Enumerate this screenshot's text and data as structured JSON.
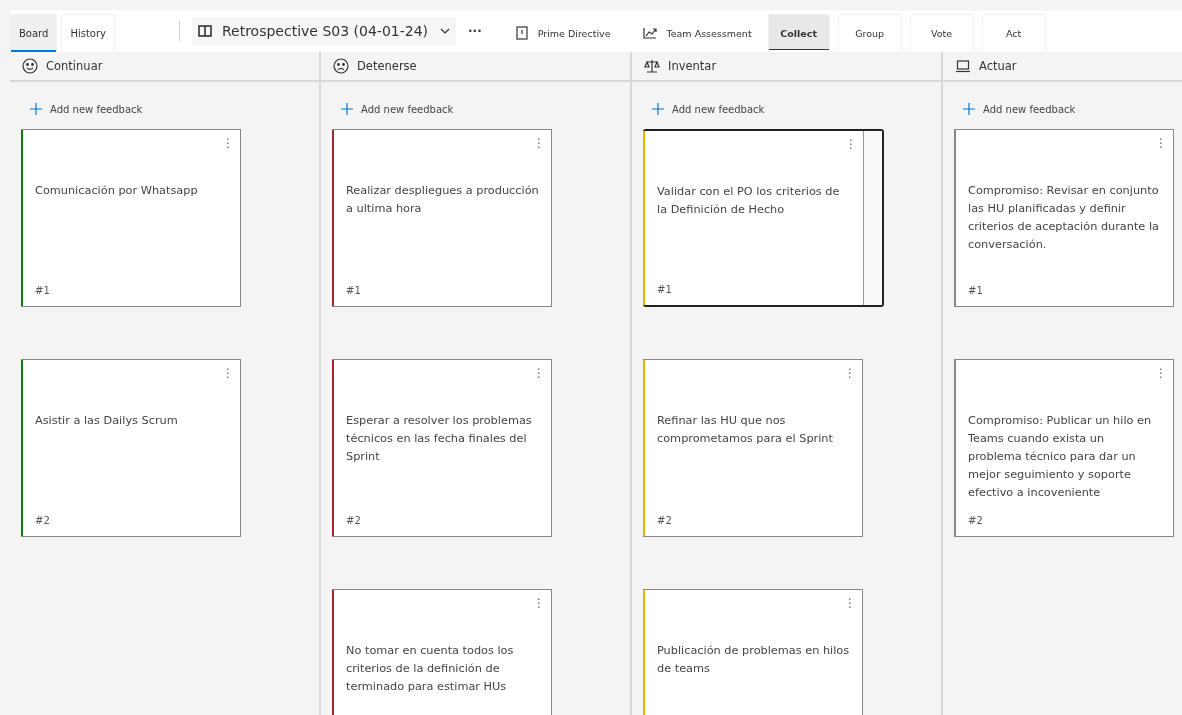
{
  "view_tabs": [
    {
      "label": "Board",
      "selected": true
    },
    {
      "label": "History",
      "selected": false
    }
  ],
  "retrospective": {
    "title": "Retrospective S03 (04-01-24)",
    "more": "···"
  },
  "actions": [
    {
      "label": "Prime Directive",
      "kind": "info"
    },
    {
      "label": "Team Assessment",
      "kind": "chart"
    }
  ],
  "phase_tabs": [
    {
      "label": "Collect",
      "selected": true
    },
    {
      "label": "Group",
      "selected": false
    },
    {
      "label": "Vote",
      "selected": false
    },
    {
      "label": "Act",
      "selected": false
    }
  ],
  "columns": [
    {
      "title": "Continuar",
      "kind": "smile",
      "color": "#107c10",
      "add_label": "Add new feedback",
      "cards": [
        {
          "text": "Comunicación por Whatsapp",
          "number": "#1",
          "focused": false,
          "menu": "⋮"
        },
        {
          "text": "Asistir a las Dailys Scrum",
          "number": "#2",
          "focused": false,
          "menu": "⋮"
        }
      ]
    },
    {
      "title": "Detenerse",
      "kind": "frown",
      "color": "#a4262c",
      "add_label": "Add new feedback",
      "cards": [
        {
          "text": "Realizar despliegues a producción a ultima hora",
          "number": "#1",
          "focused": false,
          "menu": "⋮"
        },
        {
          "text": "Esperar a resolver los problemas técnicos en las fecha finales del Sprint",
          "number": "#2",
          "focused": false,
          "menu": "⋮"
        },
        {
          "text": "No tomar en cuenta todos los criterios de la definición de terminado para estimar HUs",
          "focused": false,
          "menu": "⋮"
        }
      ]
    },
    {
      "title": "Inventar",
      "kind": "scale",
      "color": "#e8b400",
      "add_label": "Add new feedback",
      "cards": [
        {
          "text": "Validar con el PO los criterios de la Definición de Hecho",
          "number": "#1",
          "focused": true,
          "menu": "⋮"
        },
        {
          "text": "Refinar las HU que nos comprometamos para el Sprint",
          "number": "#2",
          "focused": false,
          "menu": "⋮"
        },
        {
          "text": "Publicación de problemas en hilos de teams",
          "focused": false,
          "menu": "⋮"
        }
      ]
    },
    {
      "title": "Actuar",
      "kind": "laptop",
      "color": "#8a8886",
      "add_label": "Add new feedback",
      "cards": [
        {
          "text": "Compromiso: Revisar en conjunto las HU planificadas y definir criterios de aceptación durante la conversación.",
          "number": "#1",
          "focused": false,
          "menu": "⋮"
        },
        {
          "text": "Compromiso: Publicar un hilo en Teams cuando exista un problema técnico para dar un mejor seguimiento y soporte efectivo a incoveniente",
          "number": "#2",
          "focused": false,
          "menu": "⋮"
        }
      ]
    }
  ]
}
